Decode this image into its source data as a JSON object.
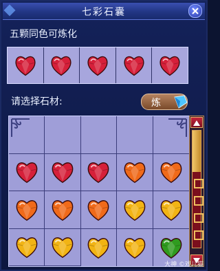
{
  "window": {
    "title": "七彩石囊"
  },
  "top_section": {
    "label": "五颗同色可炼化",
    "slots": [
      {
        "gem": "red"
      },
      {
        "gem": "red"
      },
      {
        "gem": "red"
      },
      {
        "gem": "red"
      },
      {
        "gem": "red"
      }
    ]
  },
  "select_section": {
    "label": "请选择石材:",
    "smelt_button": "炼"
  },
  "grid": {
    "rows": [
      [
        "empty",
        "empty",
        "empty",
        "empty",
        "empty"
      ],
      [
        "red",
        "red",
        "red",
        "orange",
        "orange"
      ],
      [
        "orange",
        "orange",
        "orange",
        "yellow",
        "yellow"
      ],
      [
        "yellow",
        "yellow",
        "yellow",
        "yellow",
        "green"
      ]
    ]
  },
  "colors": {
    "red": "#d6203a",
    "orange": "#f06a1a",
    "yellow": "#f2b414",
    "green": "#2f9b1f"
  },
  "watermark": "大神 ©戏儿猫"
}
